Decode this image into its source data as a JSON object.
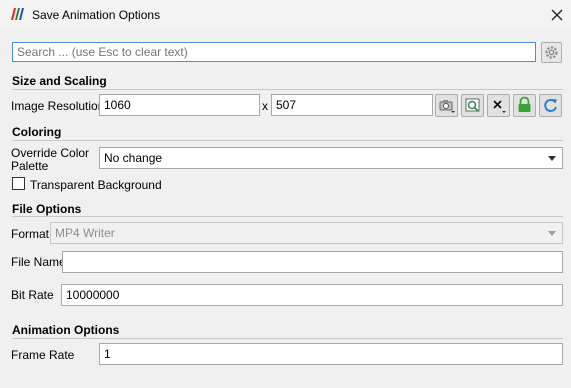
{
  "window": {
    "title": "Save Animation Options",
    "logo_icon": "paraview-logo-icon",
    "close_icon": "close-icon"
  },
  "search": {
    "placeholder": "Search ... (use Esc to clear text)",
    "value": ""
  },
  "sections": {
    "size": "Size and Scaling",
    "coloring": "Coloring",
    "file": "File Options",
    "animation": "Animation Options"
  },
  "resolution": {
    "label": "Image Resolution",
    "width": "1060",
    "separator": "x",
    "height": "507",
    "buttons": [
      "camera-icon",
      "preview-icon",
      "reset-icon",
      "lock-icon",
      "refresh-icon"
    ]
  },
  "palette": {
    "label_line1": "Override Color",
    "label_line2": "Palette",
    "value": "No change"
  },
  "transparent": {
    "label": "Transparent Background",
    "checked": false
  },
  "format": {
    "label": "Format",
    "value": "MP4 Writer"
  },
  "file_name": {
    "label": "File Name",
    "value": ""
  },
  "bit_rate": {
    "label": "Bit Rate",
    "value": "10000000"
  },
  "frame_rate": {
    "label": "Frame Rate",
    "value": "1"
  },
  "colors": {
    "accent": "#4a90d9",
    "lock_green": "#3aa33a",
    "refresh_blue": "#2e7fc8"
  }
}
